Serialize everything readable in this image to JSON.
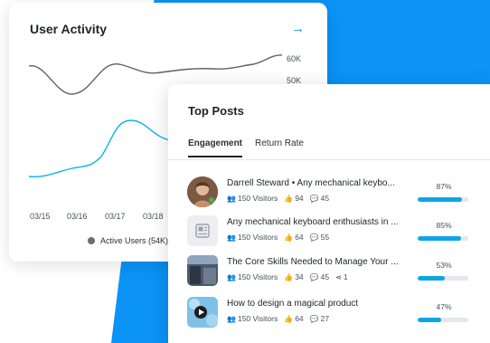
{
  "activity": {
    "title": "User Activity",
    "arrow_icon": "arrow-right-icon",
    "legend_label": "Active Users (54K)",
    "chart_data": {
      "type": "line",
      "x": [
        "03/15",
        "03/16",
        "03/17",
        "03/18"
      ],
      "yticks": [
        "60K",
        "50K"
      ],
      "ylabel": "",
      "xlabel": "",
      "series": [
        {
          "color": "#5f6166",
          "values": [
            58,
            41,
            52,
            54,
            52,
            55,
            60
          ]
        },
        {
          "color": "#0cb3e8",
          "values": [
            10,
            16,
            23,
            29,
            24,
            26,
            28
          ]
        }
      ]
    }
  },
  "posts": {
    "title": "Top Posts",
    "tabs": [
      {
        "label": "Engagement",
        "active": true
      },
      {
        "label": "Return Rate",
        "active": false
      }
    ],
    "items": [
      {
        "title": "Darrell Steward • Any mechanical keybo...",
        "visitors": "150 Visitors",
        "likes": "94",
        "comments": "45",
        "shares": "",
        "percent": "87%",
        "progress": 0.87,
        "thumb": "avatar"
      },
      {
        "title": "Any mechanical keyboard enthusiasts in ...",
        "visitors": "150 Visitors",
        "likes": "64",
        "comments": "55",
        "shares": "",
        "percent": "85%",
        "progress": 0.85,
        "thumb": "article-icon"
      },
      {
        "title": "The Core Skills Needed to Manage Your ...",
        "visitors": "150 Visitors",
        "likes": "34",
        "comments": "45",
        "shares": "1",
        "percent": "53%",
        "progress": 0.53,
        "thumb": "photo"
      },
      {
        "title": "How to design a magical product",
        "visitors": "150 Visitors",
        "likes": "64",
        "comments": "27",
        "shares": "",
        "percent": "47%",
        "progress": 0.47,
        "thumb": "video"
      }
    ]
  }
}
